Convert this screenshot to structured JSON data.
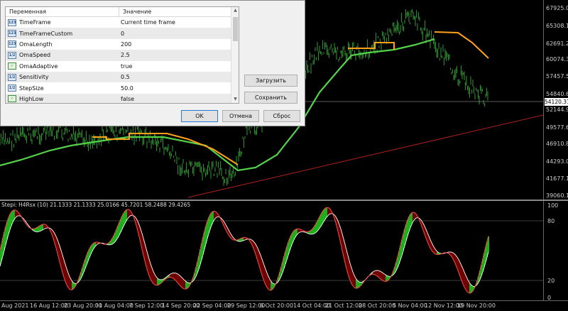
{
  "dialog": {
    "columns": {
      "name": "Переменная",
      "value": "Значение"
    },
    "params": [
      {
        "icon": "123",
        "name": "TimeFrame",
        "value": "Current time frame"
      },
      {
        "icon": "123",
        "name": "TimeFrameCustom",
        "value": "0"
      },
      {
        "icon": "123",
        "name": "OmaLength",
        "value": "200"
      },
      {
        "icon": "1/2",
        "name": "OmaSpeed",
        "value": "2.5"
      },
      {
        "icon": "bool",
        "name": "OmaAdaptive",
        "value": "true"
      },
      {
        "icon": "1/2",
        "name": "Sensitivity",
        "value": "0.5"
      },
      {
        "icon": "1/2",
        "name": "StepSize",
        "value": "50.0"
      },
      {
        "icon": "bool",
        "name": "HighLow",
        "value": "false"
      }
    ],
    "buttons": {
      "load": "Загрузить",
      "save": "Сохранить",
      "ok": "OK",
      "cancel": "Отмена",
      "reset": "Сброс"
    }
  },
  "price_axis": {
    "labels": [
      "67925.00",
      "65308.12",
      "62691.25",
      "60074.38",
      "57457.50",
      "54840.62",
      "52144.96",
      "49577.62",
      "46910.88",
      "44293.00",
      "41677.12",
      "39060.12"
    ],
    "current_price": "54120.31"
  },
  "oscillator": {
    "title": "Stepi: H4Rsx (10) 21.1333 21.1333 25.0166 45.7201 58.2488 29.4265",
    "axis_labels": [
      "100",
      "80",
      "20",
      "0"
    ]
  },
  "time_axis": {
    "labels": [
      "Aug 2021",
      "16 Aug 12:00",
      "23 Aug 20:00",
      "31 Aug 04:00",
      "7 Sep 12:00",
      "14 Sep 20:00",
      "22 Sep 04:00",
      "29 Sep 12:00",
      "6 Oct 20:00",
      "14 Oct 04:00",
      "21 Oct 12:00",
      "28 Oct 20:00",
      "5 Nov 04:00",
      "12 Nov 12:00",
      "19 Nov 20:00"
    ]
  },
  "colors": {
    "background": "#000000",
    "price_bars": "#2d8a2d",
    "step_ma_up": "#54d24a",
    "step_ma_down": "#ffa21a",
    "trendline": "#b02020",
    "osc_line_white": "#ffffff",
    "osc_fill_green": "#22dd22",
    "osc_fill_red": "#8b0000"
  }
}
